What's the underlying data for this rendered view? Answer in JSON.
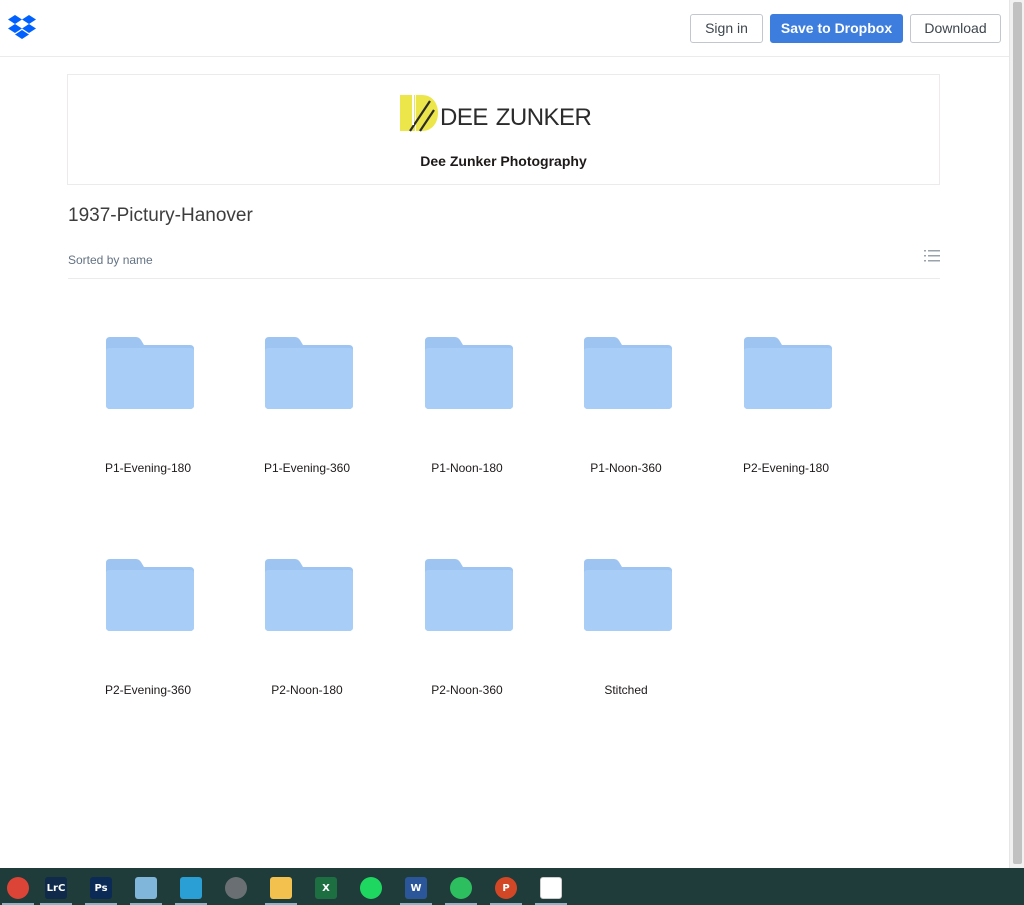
{
  "topbar": {
    "logo_icon": "dropbox-icon",
    "signin_label": "Sign in",
    "save_label": "Save to Dropbox",
    "download_label": "Download"
  },
  "banner": {
    "logo_text_part1": "Dee",
    "logo_text_part2": "Zunker",
    "name": "Dee Zunker Photography"
  },
  "folder": {
    "title": "1937-Pictury-Hanover",
    "sort_label": "Sorted by name",
    "view_icon": "list-view-icon"
  },
  "items": [
    {
      "name": "P1-Evening-180",
      "icon": "folder-icon"
    },
    {
      "name": "P1-Evening-360",
      "icon": "folder-icon"
    },
    {
      "name": "P1-Noon-180",
      "icon": "folder-icon"
    },
    {
      "name": "P1-Noon-360",
      "icon": "folder-icon"
    },
    {
      "name": "P2-Evening-180",
      "icon": "folder-icon"
    },
    {
      "name": "P2-Evening-360",
      "icon": "folder-icon"
    },
    {
      "name": "P2-Noon-180",
      "icon": "folder-icon"
    },
    {
      "name": "P2-Noon-360",
      "icon": "folder-icon"
    },
    {
      "name": "Stitched",
      "icon": "folder-icon"
    }
  ],
  "taskbar": {
    "apps": [
      {
        "icon": "chrome-icon",
        "glyph": "",
        "color": "#db4437",
        "active": true
      },
      {
        "icon": "lightroom-icon",
        "glyph": "LrC",
        "color": "#0f2a4a",
        "active": true
      },
      {
        "icon": "photoshop-icon",
        "glyph": "Ps",
        "color": "#0b2a55",
        "active": true
      },
      {
        "icon": "notepad-icon",
        "glyph": "",
        "color": "#7fb6d9",
        "active": true
      },
      {
        "icon": "magnifier-app-icon",
        "glyph": "",
        "color": "#2a9fd6",
        "active": true
      },
      {
        "icon": "globe-app-icon",
        "glyph": "",
        "color": "#6a6f73",
        "active": false
      },
      {
        "icon": "file-explorer-icon",
        "glyph": "",
        "color": "#f2c14e",
        "active": true
      },
      {
        "icon": "excel-icon",
        "glyph": "X",
        "color": "#1d6f42",
        "active": false
      },
      {
        "icon": "spotify-icon",
        "glyph": "",
        "color": "#1ed760",
        "active": false
      },
      {
        "icon": "word-icon",
        "glyph": "W",
        "color": "#2b579a",
        "active": true
      },
      {
        "icon": "evernote-icon",
        "glyph": "",
        "color": "#2dbe60",
        "active": true
      },
      {
        "icon": "powerpoint-icon",
        "glyph": "P",
        "color": "#d24726",
        "active": true
      },
      {
        "icon": "dropbox-taskbar-icon",
        "glyph": "",
        "color": "#ffffff",
        "active": true
      }
    ]
  },
  "colors": {
    "accent": "#3d7ddd",
    "folder": "#a8cdf7",
    "folder_tab": "#9ec4f2",
    "brand_yellow": "#ede64a",
    "taskbar": "#1f3b3a"
  }
}
